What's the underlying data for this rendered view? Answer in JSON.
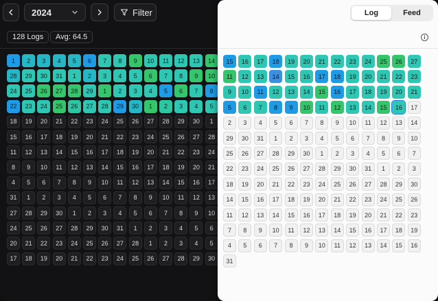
{
  "toolbar": {
    "prev_icon": "chevron-left-icon",
    "year": "2024",
    "year_icon": "chevron-down-icon",
    "next_icon": "chevron-right-icon",
    "filter_label": "Filter",
    "filter_icon": "filter-icon"
  },
  "stats": {
    "logs": "128 Logs",
    "avg": "Avg: 64.5"
  },
  "panel": {
    "tabs": [
      "Log",
      "Feed"
    ],
    "active_tab": "Log",
    "info_icon": "info-icon"
  },
  "colors": {
    "teal": "#26b7c7",
    "aqua": "#2fc6b4",
    "blue": "#1f9be6",
    "green": "#35c66d",
    "mint": "#2ec5a3",
    "selected_outline": "#1d7ee6"
  },
  "dark_grid": [
    [
      [
        "1",
        "c3"
      ],
      [
        "2",
        "c1"
      ],
      [
        "3",
        "c1"
      ],
      [
        "4",
        "c1"
      ],
      [
        "5",
        "c1"
      ],
      [
        "6",
        "c3"
      ],
      [
        "7",
        "c2"
      ],
      [
        "8",
        "c2"
      ],
      [
        "9",
        "c4"
      ],
      [
        "10",
        "c2"
      ],
      [
        "11",
        "c2"
      ],
      [
        "12",
        "c2"
      ],
      [
        "13",
        "c2"
      ],
      [
        "14",
        "c4"
      ]
    ],
    [
      [
        "28",
        "c1"
      ],
      [
        "29",
        "c2"
      ],
      [
        "30",
        "c2"
      ],
      [
        "31",
        "c2"
      ],
      [
        "1",
        "c2"
      ],
      [
        "2",
        "c1"
      ],
      [
        "3",
        "c2"
      ],
      [
        "4",
        "c2"
      ],
      [
        "5",
        "c2"
      ],
      [
        "6",
        "c4"
      ],
      [
        "7",
        "c2"
      ],
      [
        "8",
        "c2"
      ],
      [
        "9",
        "c4"
      ],
      [
        "10",
        "c4"
      ]
    ],
    [
      [
        "24",
        "c2"
      ],
      [
        "25",
        "c2"
      ],
      [
        "26",
        "c4"
      ],
      [
        "27",
        "c4"
      ],
      [
        "28",
        "c4"
      ],
      [
        "29",
        "c2"
      ],
      [
        "1",
        "c4"
      ],
      [
        "2",
        "c2"
      ],
      [
        "3",
        "c2"
      ],
      [
        "4",
        "c2"
      ],
      [
        "5",
        "c3"
      ],
      [
        "6",
        "c4"
      ],
      [
        "7",
        "c2"
      ],
      [
        "8",
        "c3"
      ]
    ],
    [
      [
        "22",
        "c3"
      ],
      [
        "23",
        "c2"
      ],
      [
        "24",
        "c2"
      ],
      [
        "25",
        "c4"
      ],
      [
        "26",
        "c5"
      ],
      [
        "27",
        "c2"
      ],
      [
        "28",
        "c2"
      ],
      [
        "29",
        "c3"
      ],
      [
        "30",
        "c1"
      ],
      [
        "1",
        "c4"
      ],
      [
        "2",
        "c5"
      ],
      [
        "3",
        "c2"
      ],
      [
        "4",
        "c2"
      ],
      [
        "5",
        "c2"
      ]
    ],
    [
      [
        "18",
        "d"
      ],
      [
        "19",
        "d"
      ],
      [
        "20",
        "d"
      ],
      [
        "21",
        "d"
      ],
      [
        "22",
        "d"
      ],
      [
        "23",
        "d"
      ],
      [
        "24",
        "d"
      ],
      [
        "25",
        "d"
      ],
      [
        "26",
        "d"
      ],
      [
        "27",
        "d"
      ],
      [
        "28",
        "d"
      ],
      [
        "29",
        "d"
      ],
      [
        "30",
        "d"
      ],
      [
        "1",
        "d"
      ]
    ],
    [
      [
        "15",
        "d"
      ],
      [
        "16",
        "d"
      ],
      [
        "17",
        "d"
      ],
      [
        "18",
        "d"
      ],
      [
        "19",
        "d"
      ],
      [
        "20",
        "d"
      ],
      [
        "21",
        "d"
      ],
      [
        "22",
        "d"
      ],
      [
        "23",
        "d"
      ],
      [
        "24",
        "d"
      ],
      [
        "25",
        "d"
      ],
      [
        "26",
        "d"
      ],
      [
        "27",
        "d"
      ],
      [
        "28",
        "d"
      ]
    ],
    [
      [
        "11",
        "d"
      ],
      [
        "12",
        "d"
      ],
      [
        "13",
        "d"
      ],
      [
        "14",
        "d"
      ],
      [
        "15",
        "d"
      ],
      [
        "16",
        "d"
      ],
      [
        "17",
        "d"
      ],
      [
        "18",
        "d"
      ],
      [
        "19",
        "d"
      ],
      [
        "20",
        "d"
      ],
      [
        "21",
        "d"
      ],
      [
        "22",
        "d"
      ],
      [
        "23",
        "d"
      ],
      [
        "24",
        "d"
      ]
    ],
    [
      [
        "8",
        "d"
      ],
      [
        "9",
        "d"
      ],
      [
        "10",
        "d"
      ],
      [
        "11",
        "d"
      ],
      [
        "12",
        "d"
      ],
      [
        "13",
        "d"
      ],
      [
        "14",
        "d"
      ],
      [
        "15",
        "d"
      ],
      [
        "16",
        "d"
      ],
      [
        "17",
        "d"
      ],
      [
        "18",
        "d"
      ],
      [
        "19",
        "d"
      ],
      [
        "20",
        "d"
      ],
      [
        "21",
        "d"
      ]
    ],
    [
      [
        "4",
        "d"
      ],
      [
        "5",
        "d"
      ],
      [
        "6",
        "d"
      ],
      [
        "7",
        "d"
      ],
      [
        "8",
        "d"
      ],
      [
        "9",
        "d"
      ],
      [
        "10",
        "d"
      ],
      [
        "11",
        "d"
      ],
      [
        "12",
        "d"
      ],
      [
        "13",
        "d"
      ],
      [
        "14",
        "d"
      ],
      [
        "15",
        "d"
      ],
      [
        "16",
        "d"
      ],
      [
        "17",
        "d"
      ]
    ],
    [
      [
        "31",
        "d"
      ],
      [
        "1",
        "d"
      ],
      [
        "2",
        "d"
      ],
      [
        "3",
        "d"
      ],
      [
        "4",
        "d"
      ],
      [
        "5",
        "d"
      ],
      [
        "6",
        "d"
      ],
      [
        "7",
        "d"
      ],
      [
        "8",
        "d"
      ],
      [
        "9",
        "d"
      ],
      [
        "10",
        "d"
      ],
      [
        "11",
        "d"
      ],
      [
        "12",
        "d"
      ],
      [
        "13",
        "d"
      ]
    ],
    [
      [
        "27",
        "d"
      ],
      [
        "28",
        "d"
      ],
      [
        "29",
        "d"
      ],
      [
        "30",
        "d"
      ],
      [
        "1",
        "d"
      ],
      [
        "2",
        "d"
      ],
      [
        "3",
        "d"
      ],
      [
        "4",
        "d"
      ],
      [
        "5",
        "d"
      ],
      [
        "6",
        "d"
      ],
      [
        "7",
        "d"
      ],
      [
        "8",
        "d"
      ],
      [
        "9",
        "d"
      ],
      [
        "10",
        "d"
      ]
    ],
    [
      [
        "24",
        "d"
      ],
      [
        "25",
        "d"
      ],
      [
        "26",
        "d"
      ],
      [
        "27",
        "d"
      ],
      [
        "28",
        "d"
      ],
      [
        "29",
        "d"
      ],
      [
        "30",
        "d"
      ],
      [
        "31",
        "d"
      ],
      [
        "1",
        "d"
      ],
      [
        "2",
        "d"
      ],
      [
        "3",
        "d"
      ],
      [
        "4",
        "d"
      ],
      [
        "5",
        "d"
      ],
      [
        "6",
        "d"
      ]
    ],
    [
      [
        "20",
        "d"
      ],
      [
        "21",
        "d"
      ],
      [
        "22",
        "d"
      ],
      [
        "23",
        "d"
      ],
      [
        "24",
        "d"
      ],
      [
        "25",
        "d"
      ],
      [
        "26",
        "d"
      ],
      [
        "27",
        "d"
      ],
      [
        "28",
        "d"
      ],
      [
        "1",
        "d"
      ],
      [
        "2",
        "d"
      ],
      [
        "3",
        "d"
      ],
      [
        "4",
        "d"
      ],
      [
        "5",
        "d"
      ]
    ],
    [
      [
        "17",
        "d"
      ],
      [
        "18",
        "d"
      ],
      [
        "19",
        "d"
      ],
      [
        "20",
        "d"
      ],
      [
        "21",
        "d"
      ],
      [
        "22",
        "d"
      ],
      [
        "23",
        "d"
      ],
      [
        "24",
        "d"
      ],
      [
        "25",
        "d"
      ],
      [
        "26",
        "d"
      ],
      [
        "27",
        "d"
      ],
      [
        "28",
        "d"
      ],
      [
        "29",
        "d"
      ],
      [
        "30",
        "d"
      ]
    ]
  ],
  "light_grid": [
    [
      [
        "15",
        "c3"
      ],
      [
        "16",
        "c2"
      ],
      [
        "17",
        "c2"
      ],
      [
        "18",
        "c3"
      ],
      [
        "19",
        "c2"
      ],
      [
        "20",
        "c2"
      ],
      [
        "21",
        "c2"
      ],
      [
        "22",
        "c2"
      ],
      [
        "23",
        "c2"
      ],
      [
        "24",
        "c2"
      ],
      [
        "25",
        "c4"
      ],
      [
        "26",
        "c4"
      ],
      [
        "27",
        "c2"
      ]
    ],
    [
      [
        "11",
        "c4"
      ],
      [
        "12",
        "c2"
      ],
      [
        "13",
        "c2"
      ],
      [
        "14",
        "c3s"
      ],
      [
        "15",
        "c2"
      ],
      [
        "16",
        "c2"
      ],
      [
        "17",
        "c3"
      ],
      [
        "18",
        "c3"
      ],
      [
        "19",
        "c2"
      ],
      [
        "20",
        "c2"
      ],
      [
        "21",
        "c2"
      ],
      [
        "22",
        "c2"
      ],
      [
        "23",
        "c2"
      ]
    ],
    [
      [
        "9",
        "c2"
      ],
      [
        "10",
        "c2"
      ],
      [
        "11",
        "c3"
      ],
      [
        "12",
        "c2"
      ],
      [
        "13",
        "c2"
      ],
      [
        "14",
        "c2"
      ],
      [
        "15",
        "c4"
      ],
      [
        "16",
        "c3"
      ],
      [
        "17",
        "c2"
      ],
      [
        "18",
        "c2"
      ],
      [
        "19",
        "c2"
      ],
      [
        "20",
        "c2"
      ],
      [
        "21",
        "c2"
      ]
    ],
    [
      [
        "5",
        "c3"
      ],
      [
        "6",
        "c2"
      ],
      [
        "7",
        "c2"
      ],
      [
        "8",
        "c3"
      ],
      [
        "9",
        "c3"
      ],
      [
        "10",
        "c4"
      ],
      [
        "11",
        "c2"
      ],
      [
        "12",
        "c4"
      ],
      [
        "13",
        "c2"
      ],
      [
        "14",
        "c2"
      ],
      [
        "15",
        "c4"
      ],
      [
        "16",
        "sel"
      ],
      [
        "17",
        "l"
      ]
    ],
    [
      [
        "2",
        "l"
      ],
      [
        "3",
        "l"
      ],
      [
        "4",
        "l"
      ],
      [
        "5",
        "l"
      ],
      [
        "6",
        "l"
      ],
      [
        "7",
        "l"
      ],
      [
        "8",
        "l"
      ],
      [
        "9",
        "l"
      ],
      [
        "10",
        "l"
      ],
      [
        "11",
        "l"
      ],
      [
        "12",
        "l"
      ],
      [
        "13",
        "l"
      ],
      [
        "14",
        "l"
      ]
    ],
    [
      [
        "29",
        "l"
      ],
      [
        "30",
        "l"
      ],
      [
        "31",
        "l"
      ],
      [
        "1",
        "l"
      ],
      [
        "2",
        "l"
      ],
      [
        "3",
        "l"
      ],
      [
        "4",
        "l"
      ],
      [
        "5",
        "l"
      ],
      [
        "6",
        "l"
      ],
      [
        "7",
        "l"
      ],
      [
        "8",
        "l"
      ],
      [
        "9",
        "l"
      ],
      [
        "10",
        "l"
      ]
    ],
    [
      [
        "25",
        "l"
      ],
      [
        "26",
        "l"
      ],
      [
        "27",
        "l"
      ],
      [
        "28",
        "l"
      ],
      [
        "29",
        "l"
      ],
      [
        "30",
        "l"
      ],
      [
        "1",
        "l"
      ],
      [
        "2",
        "l"
      ],
      [
        "3",
        "l"
      ],
      [
        "4",
        "l"
      ],
      [
        "5",
        "l"
      ],
      [
        "6",
        "l"
      ],
      [
        "7",
        "l"
      ]
    ],
    [
      [
        "22",
        "l"
      ],
      [
        "23",
        "l"
      ],
      [
        "24",
        "l"
      ],
      [
        "25",
        "l"
      ],
      [
        "26",
        "l"
      ],
      [
        "27",
        "l"
      ],
      [
        "28",
        "l"
      ],
      [
        "29",
        "l"
      ],
      [
        "30",
        "l"
      ],
      [
        "31",
        "l"
      ],
      [
        "1",
        "l"
      ],
      [
        "2",
        "l"
      ],
      [
        "3",
        "l"
      ]
    ],
    [
      [
        "18",
        "l"
      ],
      [
        "19",
        "l"
      ],
      [
        "20",
        "l"
      ],
      [
        "21",
        "l"
      ],
      [
        "22",
        "l"
      ],
      [
        "23",
        "l"
      ],
      [
        "24",
        "l"
      ],
      [
        "25",
        "l"
      ],
      [
        "26",
        "l"
      ],
      [
        "27",
        "l"
      ],
      [
        "28",
        "l"
      ],
      [
        "29",
        "l"
      ],
      [
        "30",
        "l"
      ]
    ],
    [
      [
        "14",
        "l"
      ],
      [
        "15",
        "l"
      ],
      [
        "16",
        "l"
      ],
      [
        "17",
        "l"
      ],
      [
        "18",
        "l"
      ],
      [
        "19",
        "l"
      ],
      [
        "20",
        "l"
      ],
      [
        "21",
        "l"
      ],
      [
        "22",
        "l"
      ],
      [
        "23",
        "l"
      ],
      [
        "24",
        "l"
      ],
      [
        "25",
        "l"
      ],
      [
        "26",
        "l"
      ]
    ],
    [
      [
        "11",
        "l"
      ],
      [
        "12",
        "l"
      ],
      [
        "13",
        "l"
      ],
      [
        "14",
        "l"
      ],
      [
        "15",
        "l"
      ],
      [
        "16",
        "l"
      ],
      [
        "17",
        "l"
      ],
      [
        "18",
        "l"
      ],
      [
        "19",
        "l"
      ],
      [
        "20",
        "l"
      ],
      [
        "21",
        "l"
      ],
      [
        "22",
        "l"
      ],
      [
        "23",
        "l"
      ]
    ],
    [
      [
        "7",
        "l"
      ],
      [
        "8",
        "l"
      ],
      [
        "9",
        "l"
      ],
      [
        "10",
        "l"
      ],
      [
        "11",
        "l"
      ],
      [
        "12",
        "l"
      ],
      [
        "13",
        "l"
      ],
      [
        "14",
        "l"
      ],
      [
        "15",
        "l"
      ],
      [
        "16",
        "l"
      ],
      [
        "17",
        "l"
      ],
      [
        "18",
        "l"
      ],
      [
        "19",
        "l"
      ]
    ],
    [
      [
        "4",
        "l"
      ],
      [
        "5",
        "l"
      ],
      [
        "6",
        "l"
      ],
      [
        "7",
        "l"
      ],
      [
        "8",
        "l"
      ],
      [
        "9",
        "l"
      ],
      [
        "10",
        "l"
      ],
      [
        "11",
        "l"
      ],
      [
        "12",
        "l"
      ],
      [
        "13",
        "l"
      ],
      [
        "14",
        "l"
      ],
      [
        "15",
        "l"
      ],
      [
        "16",
        "l"
      ]
    ],
    [
      [
        "31",
        "l"
      ]
    ]
  ]
}
